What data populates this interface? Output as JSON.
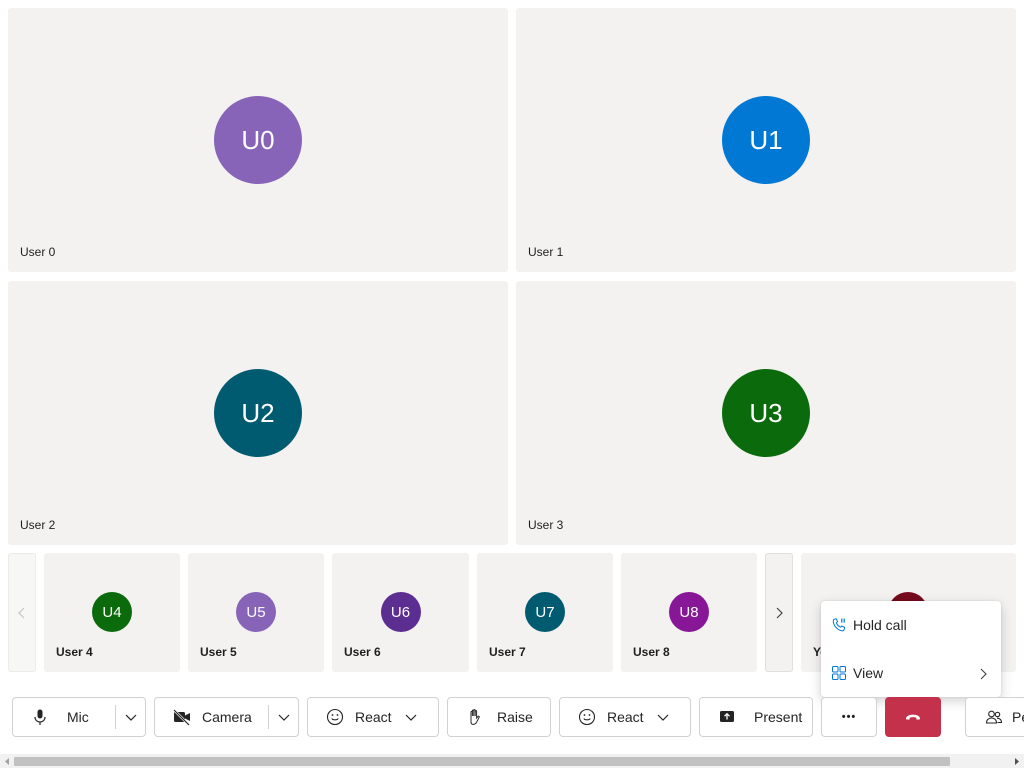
{
  "main_tiles": [
    {
      "initials": "U0",
      "name": "User 0",
      "color": "#8764b8"
    },
    {
      "initials": "U1",
      "name": "User 1",
      "color": "#0078d4"
    },
    {
      "initials": "U2",
      "name": "User 2",
      "color": "#005b70"
    },
    {
      "initials": "U3",
      "name": "User 3",
      "color": "#0b6a0b"
    }
  ],
  "strip_tiles": [
    {
      "initials": "U4",
      "name": "User 4",
      "color": "#0b6a0b"
    },
    {
      "initials": "U5",
      "name": "User 5",
      "color": "#8764b8"
    },
    {
      "initials": "U6",
      "name": "User 6",
      "color": "#5c2e91"
    },
    {
      "initials": "U7",
      "name": "User 7",
      "color": "#005b70"
    },
    {
      "initials": "U8",
      "name": "User 8",
      "color": "#881798"
    }
  ],
  "partial_tile": {
    "name": "Yo",
    "color": "#750b1c"
  },
  "toolbar": {
    "mic_label": "Mic",
    "camera_label": "Camera",
    "react1_label": "React",
    "raise_label": "Raise",
    "react2_label": "React",
    "present_label": "Present",
    "more_label": "•••",
    "people_label": "Pe"
  },
  "more_menu": {
    "items": [
      {
        "label": "Hold call",
        "icon": "phone-pause-icon"
      },
      {
        "label": "View",
        "icon": "grid-view-icon"
      }
    ]
  },
  "colors": {
    "tile_bg": "#f3f2f1",
    "hangup": "#c4314b",
    "menu_icon": "#0078d4"
  }
}
